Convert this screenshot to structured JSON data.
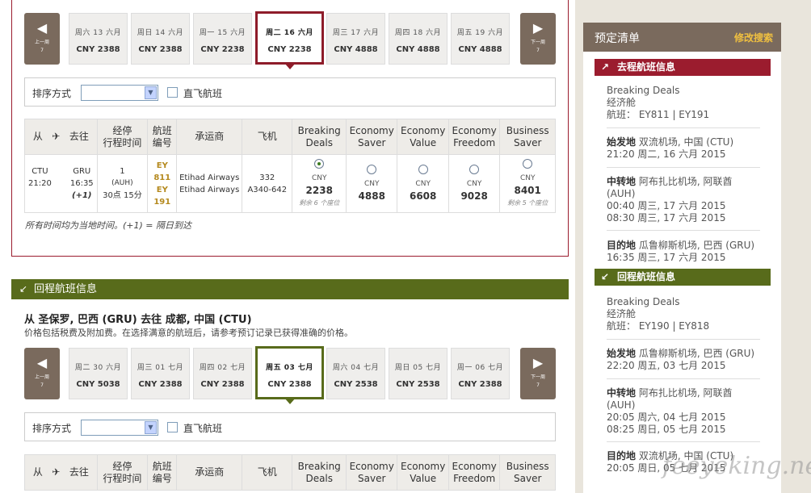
{
  "outbound": {
    "prev": {
      "label": "上一周",
      "num": "7"
    },
    "next": {
      "label": "下一周",
      "num": "7"
    },
    "dates": [
      {
        "day": "周六 13 六月",
        "price": "CNY 2388"
      },
      {
        "day": "周日 14 六月",
        "price": "CNY 2388"
      },
      {
        "day": "周一 15 六月",
        "price": "CNY 2238"
      },
      {
        "day": "周二 16 六月",
        "price": "CNY 2238"
      },
      {
        "day": "周三 17 六月",
        "price": "CNY 4888"
      },
      {
        "day": "周四 18 六月",
        "price": "CNY 4888"
      },
      {
        "day": "周五 19 六月",
        "price": "CNY 4888"
      }
    ],
    "sort_label": "排序方式",
    "direct_label": "直飞航班",
    "headers": {
      "from": "从",
      "to": "去往",
      "stops": "经停\n行程时间",
      "flight": "航班\n编号",
      "carrier": "承运商",
      "aircraft": "飞机",
      "breaking": "Breaking\nDeals",
      "eco_saver": "Economy\nSaver",
      "eco_value": "Economy\nValue",
      "eco_freedom": "Economy\nFreedom",
      "biz_saver": "Business\nSaver"
    },
    "row": {
      "dep_code": "CTU",
      "dep_time": "21:20",
      "arr_code": "GRU",
      "arr_time": "16:35",
      "arr_plus": "(+1)",
      "stops": "1",
      "via": "(AUH)",
      "duration": "30点 15分",
      "fn1": "EY 811",
      "fn2": "EY 191",
      "carrier1": "Etihad Airways",
      "carrier2": "Etihad Airways",
      "ac1": "332",
      "ac2": "A340-642",
      "fares": [
        {
          "cur": "CNY",
          "amt": "2238",
          "left": "剩余 6 个座位",
          "selected": true
        },
        {
          "cur": "CNY",
          "amt": "4888",
          "left": "",
          "selected": false
        },
        {
          "cur": "CNY",
          "amt": "6608",
          "left": "",
          "selected": false
        },
        {
          "cur": "CNY",
          "amt": "9028",
          "left": "",
          "selected": false
        },
        {
          "cur": "CNY",
          "amt": "8401",
          "left": "剩余 5 个座位",
          "selected": false
        }
      ]
    },
    "note": "所有时间均为当地时间。(+1) = 隔日到达"
  },
  "return": {
    "bar_label": "回程航班信息",
    "title": "从 圣保罗, 巴西 (GRU) 去往 成都, 中国 (CTU)",
    "subtitle": "价格包括税费及附加费。在选择满意的航班后，请参考预订记录已获得准确的价格。",
    "prev": {
      "label": "上一周",
      "num": "7"
    },
    "next": {
      "label": "下一周",
      "num": "7"
    },
    "dates": [
      {
        "day": "周二 30 六月",
        "price": "CNY 5038"
      },
      {
        "day": "周三 01 七月",
        "price": "CNY 2388"
      },
      {
        "day": "周四 02 七月",
        "price": "CNY 2388"
      },
      {
        "day": "周五 03 七月",
        "price": "CNY 2388"
      },
      {
        "day": "周六 04 七月",
        "price": "CNY 2538"
      },
      {
        "day": "周日 05 七月",
        "price": "CNY 2538"
      },
      {
        "day": "周一 06 七月",
        "price": "CNY 2388"
      }
    ],
    "sort_label": "排序方式",
    "direct_label": "直飞航班"
  },
  "sidebar": {
    "title": "预定清单",
    "modify": "修改搜索",
    "out_bar": "去程航班信息",
    "out_fare": "Breaking Deals",
    "out_cabin": "经济舱",
    "out_flights": "航班： EY811 | EY191",
    "out_origin_lbl": "始发地",
    "out_origin": "双流机场, 中国 (CTU)",
    "out_origin_time": "21:20 周二, 16 六月 2015",
    "out_transit_lbl": "中转地",
    "out_transit": "阿布扎比机场, 阿联酋 (AUH)",
    "out_transit_t1": "00:40 周三, 17 六月 2015",
    "out_transit_t2": "08:30 周三, 17 六月 2015",
    "out_dest_lbl": "目的地",
    "out_dest": "瓜鲁柳斯机场, 巴西 (GRU)",
    "out_dest_time": "16:35 周三, 17 六月 2015",
    "ret_bar": "回程航班信息",
    "ret_fare": "Breaking Deals",
    "ret_cabin": "经济舱",
    "ret_flights": "航班： EY190 | EY818",
    "ret_origin_lbl": "始发地",
    "ret_origin": "瓜鲁柳斯机场, 巴西 (GRU)",
    "ret_origin_time": "22:20 周五, 03 七月 2015",
    "ret_transit_lbl": "中转地",
    "ret_transit": "阿布扎比机场, 阿联酋 (AUH)",
    "ret_transit_t1": "20:05 周六, 04 七月 2015",
    "ret_transit_t2": "08:25 周日, 05 七月 2015",
    "ret_dest_lbl": "目的地",
    "ret_dest": "双流机场, 中国 (CTU)",
    "ret_dest_time": "20:05 周日, 05 七月 2015"
  },
  "watermark": "feeyeking.net",
  "colors": {
    "outbound": "#9b1c2e",
    "return": "#586b1b",
    "brown": "#7a6a5d",
    "gold": "#f0c040"
  }
}
